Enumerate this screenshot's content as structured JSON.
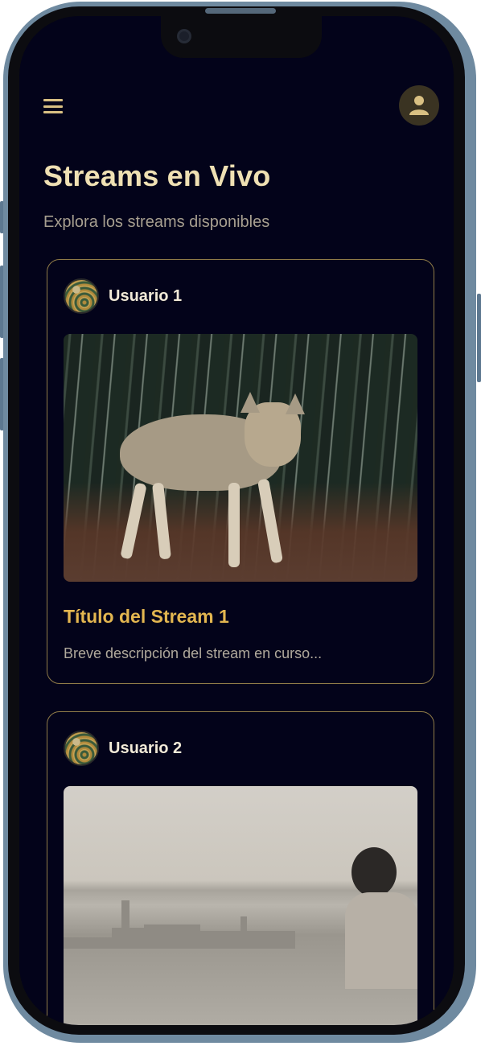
{
  "header": {
    "menu_icon": "hamburger-menu-icon",
    "profile_icon": "person-icon"
  },
  "page": {
    "title": "Streams en Vivo",
    "subtitle": "Explora los streams disponibles"
  },
  "streams": [
    {
      "user": "Usuario 1",
      "title": "Título del Stream 1",
      "description": "Breve descripción del stream en curso...",
      "thumbnail": "wolf in forest"
    },
    {
      "user": "Usuario 2",
      "thumbnail": "person looking at city skyline over water"
    }
  ],
  "colors": {
    "background": "#03031a",
    "accent": "#e3b650",
    "title_text": "#efe0b3",
    "card_border": "#8f7b48"
  }
}
